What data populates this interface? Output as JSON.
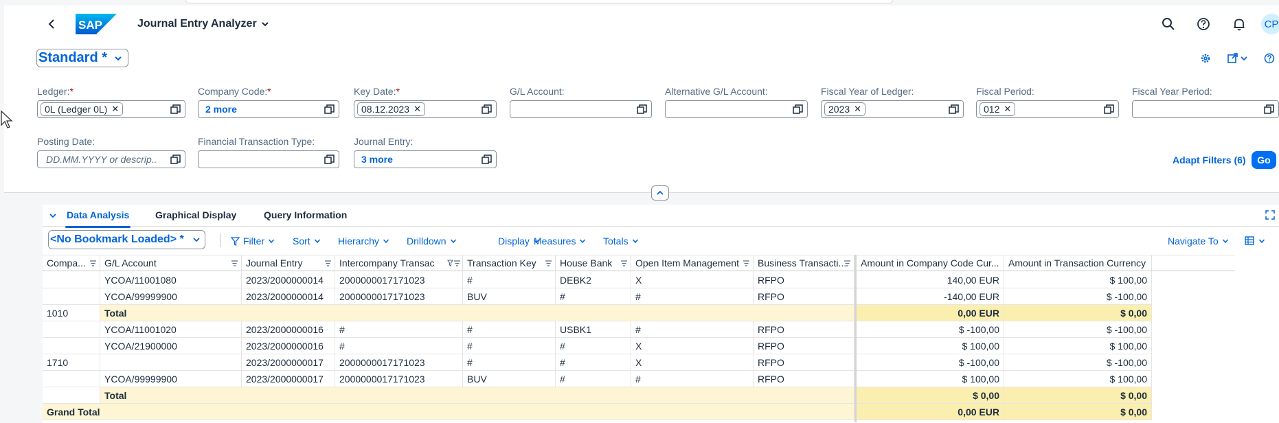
{
  "app": {
    "title": "Journal Entry Analyzer",
    "logo_text": "SAP",
    "avatar_initials": "CP"
  },
  "variant": {
    "label": "Standard *"
  },
  "filters": {
    "ledger": {
      "label": "Ledger:",
      "required": "*",
      "token": "0L (Ledger 0L)"
    },
    "company_code": {
      "label": "Company Code:",
      "required": "*",
      "more": "2 more"
    },
    "key_date": {
      "label": "Key Date:",
      "required": "*",
      "token": "08.12.2023"
    },
    "gl_account": {
      "label": "G/L Account:"
    },
    "alt_gl_account": {
      "label": "Alternative G/L Account:"
    },
    "fiscal_year": {
      "label": "Fiscal Year of Ledger:",
      "token": "2023"
    },
    "fiscal_period": {
      "label": "Fiscal Period:",
      "token": "012"
    },
    "fiscal_year_period": {
      "label": "Fiscal Year Period:"
    },
    "posting_date": {
      "label": "Posting Date:",
      "placeholder": "DD.MM.YYYY or descrip..."
    },
    "fin_trans_type": {
      "label": "Financial Transaction Type:"
    },
    "journal_entry": {
      "label": "Journal Entry:",
      "more": "3 more"
    },
    "adapt_label": "Adapt Filters (6)",
    "go_label": "Go"
  },
  "tabs": [
    "Data Analysis",
    "Graphical Display",
    "Query Information"
  ],
  "toolbar": {
    "bookmark": "<No Bookmark Loaded> *",
    "filter": "Filter",
    "sort": "Sort",
    "hierarchy": "Hierarchy",
    "drilldown": "Drilldown",
    "display": "Display",
    "measures": "Measures",
    "totals": "Totals",
    "navigate": "Navigate To"
  },
  "table": {
    "columns": [
      "Compa...",
      "G/L Account",
      "Journal Entry",
      "Intercompany Transac",
      "Transaction Key",
      "House Bank",
      "Open Item Management",
      "Business Transacti...",
      "Amount in Company Code Cur...",
      "Amount in Transaction Currency"
    ],
    "rows": [
      {
        "company": "",
        "gl": "YCOA/11001080",
        "je": "2023/2000000014",
        "ic": "2000000017171023",
        "tk": "#",
        "hb": "DEBK2",
        "oim": "X",
        "bt": "RFPO",
        "amt_cc": "140,00 EUR",
        "amt_tc": "$ 100,00"
      },
      {
        "company": "",
        "gl": "YCOA/99999900",
        "je": "2023/2000000014",
        "ic": "2000000017171023",
        "tk": "BUV",
        "hb": "#",
        "oim": "#",
        "bt": "RFPO",
        "amt_cc": "-140,00 EUR",
        "amt_tc": "$ -100,00"
      },
      {
        "company": "1010",
        "total": "Total",
        "amt_cc": "0,00 EUR",
        "amt_tc": "$ 0,00"
      },
      {
        "company": "",
        "gl": "YCOA/11001020",
        "je": "2023/2000000016",
        "ic": "#",
        "tk": "#",
        "hb": "USBK1",
        "oim": "#",
        "bt": "RFPO",
        "amt_cc": "$ -100,00",
        "amt_tc": "$ -100,00"
      },
      {
        "company": "",
        "gl": "YCOA/21900000",
        "je": "2023/2000000016",
        "ic": "#",
        "tk": "#",
        "hb": "#",
        "oim": "X",
        "bt": "RFPO",
        "amt_cc": "$ 100,00",
        "amt_tc": "$ 100,00"
      },
      {
        "company": "1710",
        "gl": "",
        "je": "2023/2000000017",
        "ic": "2000000017171023",
        "tk": "#",
        "hb": "#",
        "oim": "X",
        "bt": "RFPO",
        "amt_cc": "$ -100,00",
        "amt_tc": "$ -100,00"
      },
      {
        "company": "",
        "gl": "YCOA/99999900",
        "je": "2023/2000000017",
        "ic": "2000000017171023",
        "tk": "BUV",
        "hb": "#",
        "oim": "#",
        "bt": "RFPO",
        "amt_cc": "$ 100,00",
        "amt_tc": "$ 100,00"
      },
      {
        "company": "",
        "total": "Total",
        "amt_cc": "$ 0,00",
        "amt_tc": "$ 0,00"
      }
    ],
    "grand_total": {
      "label": "Grand Total",
      "amt_cc": "0,00 EUR",
      "amt_tc": "$ 0,00"
    }
  }
}
